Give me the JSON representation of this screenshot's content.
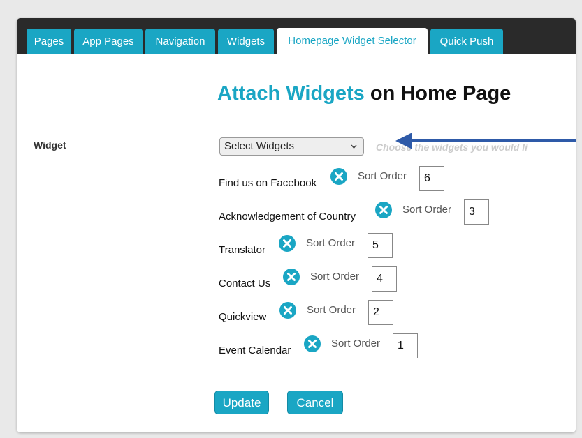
{
  "tabs": [
    {
      "label": "Pages"
    },
    {
      "label": "App Pages"
    },
    {
      "label": "Navigation"
    },
    {
      "label": "Widgets"
    },
    {
      "label": "Homepage Widget Selector"
    },
    {
      "label": "Quick Push"
    }
  ],
  "active_tab": "Homepage Widget Selector",
  "heading": {
    "accent": "Attach Widgets",
    "rest": "on Home Page"
  },
  "form": {
    "widget_label": "Widget",
    "select_value": "Select Widgets",
    "hint": "Choose the widgets you would li"
  },
  "rows": [
    {
      "name": "Find us on Facebook",
      "sort_label": "Sort Order",
      "sort_value": "6"
    },
    {
      "name": "Acknowledgement of Country",
      "sort_label": "Sort Order",
      "sort_value": "3"
    },
    {
      "name": "Translator",
      "sort_label": "Sort Order",
      "sort_value": "5"
    },
    {
      "name": "Contact Us",
      "sort_label": "Sort Order",
      "sort_value": "4"
    },
    {
      "name": "Quickview",
      "sort_label": "Sort Order",
      "sort_value": "2"
    },
    {
      "name": "Event Calendar",
      "sort_label": "Sort Order",
      "sort_value": "1"
    }
  ],
  "buttons": {
    "update": "Update",
    "cancel": "Cancel"
  },
  "colors": {
    "accent": "#1aa6c4",
    "tabbar": "#2a2a2a",
    "arrow": "#2e5aa8"
  },
  "icons": {
    "remove": "remove-x-circle-icon",
    "annotation": "annotation-arrow"
  }
}
